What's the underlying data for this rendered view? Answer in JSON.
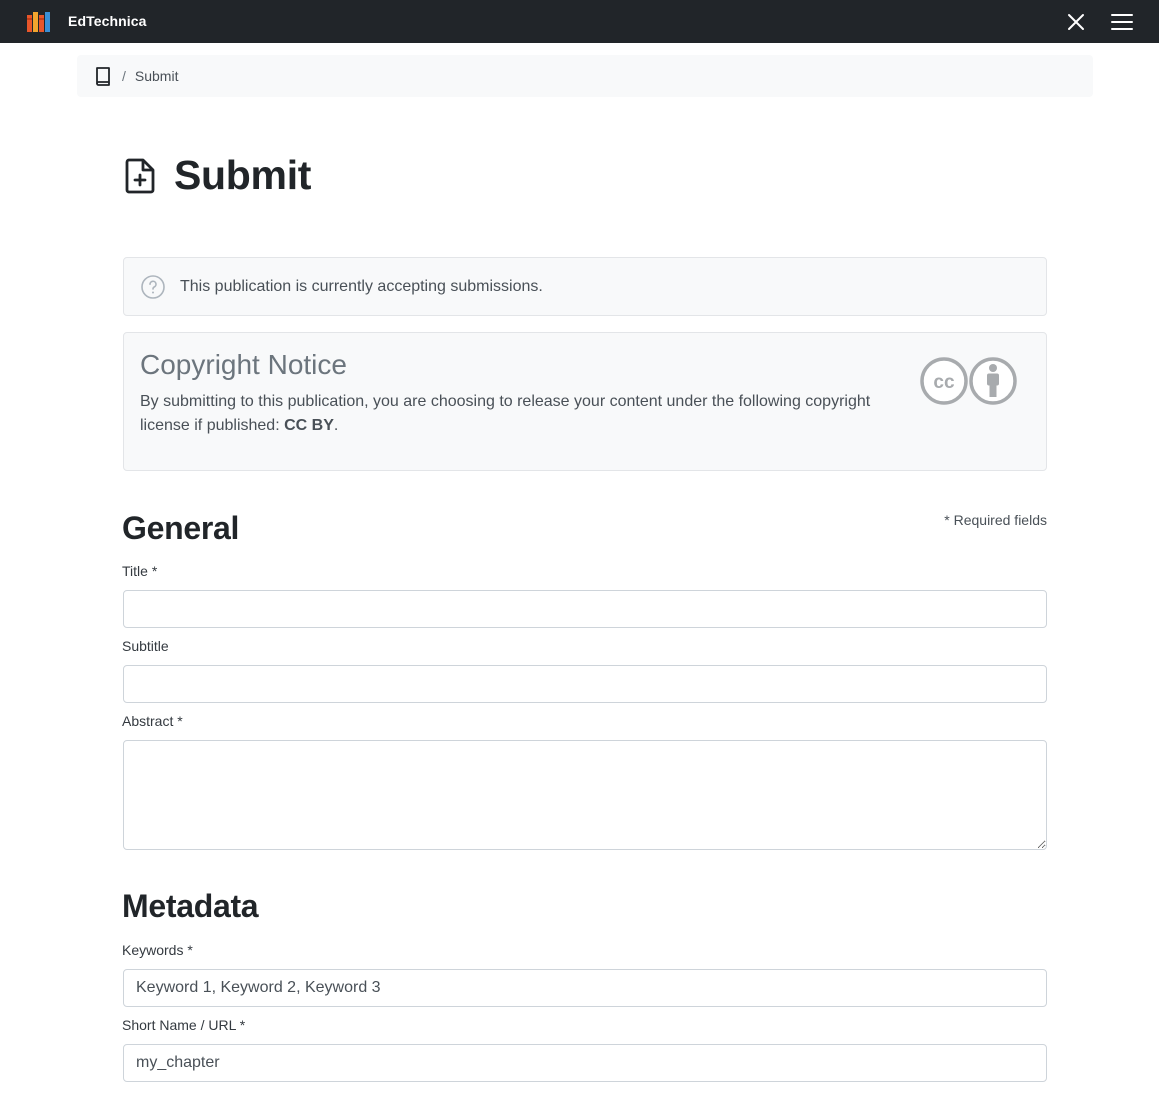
{
  "app": {
    "title": "EdTechnica",
    "logo_icon": "books-logo-icon",
    "close_icon": "close-icon",
    "menu_icon": "hamburger-menu-icon"
  },
  "breadcrumb": {
    "home_icon": "book-icon",
    "separator": "/",
    "current": "Submit"
  },
  "page": {
    "icon": "file-plus-icon",
    "title": "Submit"
  },
  "notice": {
    "icon": "question-circle-icon",
    "text": "This publication is currently accepting submissions."
  },
  "copyright": {
    "title": "Copyright Notice",
    "body_prefix": "By submitting to this publication, you are choosing to release your content under the following copyright license if published: ",
    "license": "CC BY",
    "body_suffix": ".",
    "badge_icon": "cc-by-license-icon"
  },
  "general": {
    "heading": "General",
    "required_note": "* Required fields",
    "title_label": "Title *",
    "title_value": "",
    "subtitle_label": "Subtitle",
    "subtitle_value": "",
    "abstract_label": "Abstract *",
    "abstract_value": ""
  },
  "metadata": {
    "heading": "Metadata",
    "keywords_label": "Keywords *",
    "keywords_placeholder": "Keyword 1, Keyword 2, Keyword 3",
    "shortname_label": "Short Name / URL *",
    "shortname_placeholder": "my_chapter"
  },
  "colors": {
    "topbar_bg": "#212529",
    "panel_bg": "#f8f9fa",
    "border": "#ced4da",
    "heading": "#212529",
    "muted": "#6c757d"
  }
}
